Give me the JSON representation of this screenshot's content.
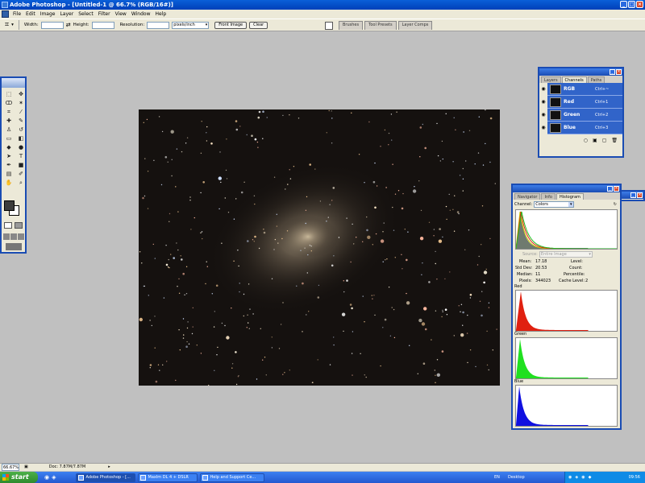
{
  "window": {
    "title": "Adobe Photoshop - [Untitled-1 @ 66.7% (RGB/16#)]"
  },
  "menu": [
    "File",
    "Edit",
    "Image",
    "Layer",
    "Select",
    "Filter",
    "View",
    "Window",
    "Help"
  ],
  "options": {
    "width_label": "Width:",
    "height_label": "Height:",
    "resolution_label": "Resolution:",
    "resolution_unit": "pixels/inch",
    "front_image_label": "Front Image",
    "clear_label": "Clear"
  },
  "well_tabs": [
    "Brushes",
    "Tool Presets",
    "Layer Comps"
  ],
  "layers_panel": {
    "tabs": [
      "Layers",
      "Channels",
      "Paths"
    ],
    "active_tab": "Channels",
    "channels": [
      {
        "name": "RGB",
        "shortcut": "Ctrl+~"
      },
      {
        "name": "Red",
        "shortcut": "Ctrl+1"
      },
      {
        "name": "Green",
        "shortcut": "Ctrl+2"
      },
      {
        "name": "Blue",
        "shortcut": "Ctrl+3"
      }
    ]
  },
  "histogram_panel": {
    "tabs": [
      "Navigator",
      "Info",
      "Histogram"
    ],
    "active_tab": "Histogram",
    "channel_label": "Channel:",
    "channel_value": "Colors",
    "source_label": "Source:",
    "source_value": "Entire Image",
    "stats": {
      "mean_label": "Mean:",
      "mean": "17.18",
      "std_label": "Std Dev:",
      "std": "20.53",
      "median_label": "Median:",
      "median": "11",
      "pixels_label": "Pixels:",
      "pixels": "344023",
      "level_label": "Level:",
      "count_label": "Count:",
      "percentile_label": "Percentile:",
      "cache_label": "Cache Level:",
      "cache": "2"
    },
    "channel_titles": [
      "Red",
      "Green",
      "Blue"
    ],
    "colors": {
      "red": "#e02010",
      "green": "#20e020",
      "blue": "#1010e0"
    }
  },
  "status": {
    "zoom": "66.67%",
    "doc": "Doc: 7.87M/7.87M"
  },
  "taskbar": {
    "start": "start",
    "buttons": [
      "Adobe Photoshop - [...",
      "MaxIm DL 4 + DSLR",
      "Help and Support Ce..."
    ],
    "lang": "EN",
    "desktop": "Desktop",
    "clock": "09:56"
  }
}
